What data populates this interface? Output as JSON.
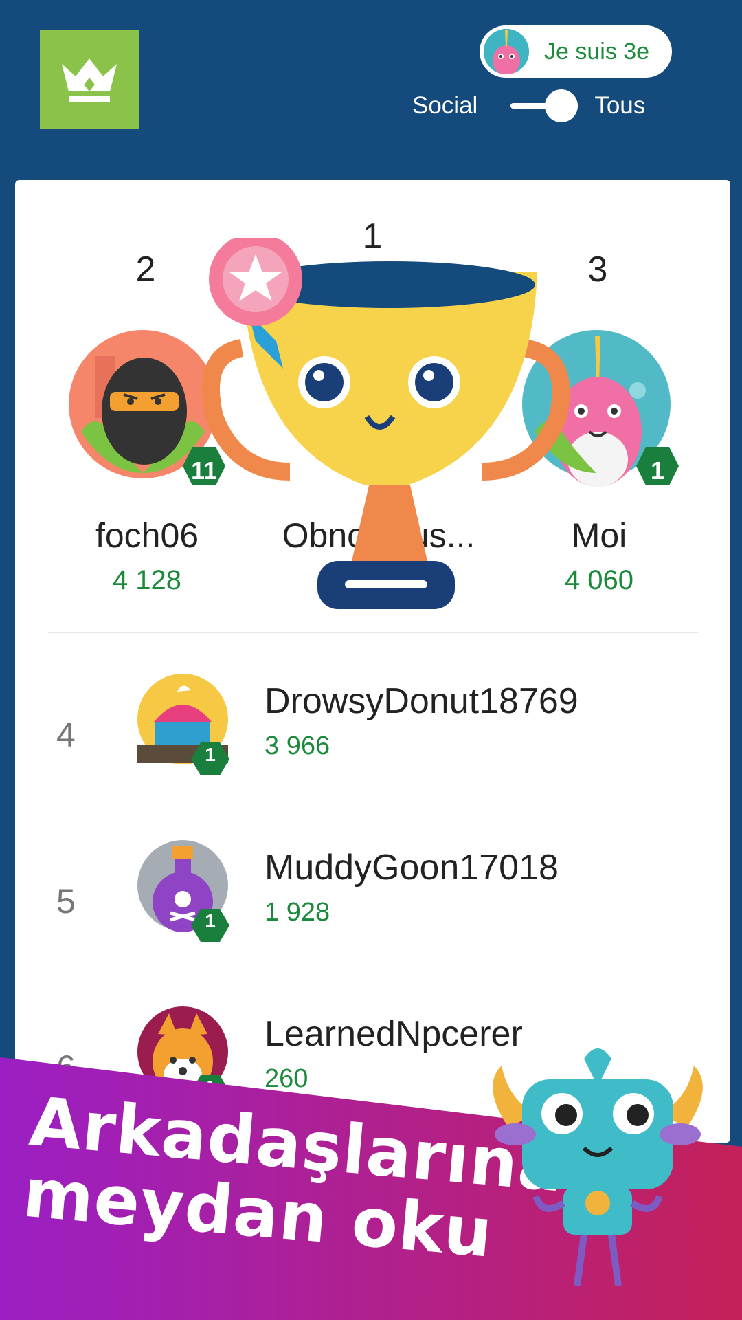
{
  "header": {
    "crown_icon": "crown-icon",
    "rank_pill_text": "Je suis 3e",
    "toggle_left": "Social",
    "toggle_right": "Tous",
    "toggle_state": "Tous"
  },
  "podium": [
    {
      "place": "2",
      "name": "foch06",
      "score": "4 128",
      "level": "11"
    },
    {
      "place": "1",
      "name": "Obnoxious...",
      "score": "",
      "level": ""
    },
    {
      "place": "3",
      "name": "Moi",
      "score": "4 060",
      "level": "1"
    }
  ],
  "leaderboard": [
    {
      "rank": "4",
      "name": "DrowsyDonut18769",
      "score": "3 966",
      "level": "1"
    },
    {
      "rank": "5",
      "name": "MuddyGoon17018",
      "score": "1 928",
      "level": "1"
    },
    {
      "rank": "6",
      "name": "LearnedNpcerer",
      "score": "260",
      "level": "1"
    }
  ],
  "promo": {
    "line1": "Arkadaşlarına",
    "line2": "meydan oku"
  },
  "colors": {
    "background": "#154b7c",
    "crown_button": "#8bc34a",
    "score_green": "#1b8a3a",
    "level_badge": "#1a7f3c",
    "promo_gradient_start": "#9b1fc4",
    "promo_gradient_end": "#c4215a"
  }
}
